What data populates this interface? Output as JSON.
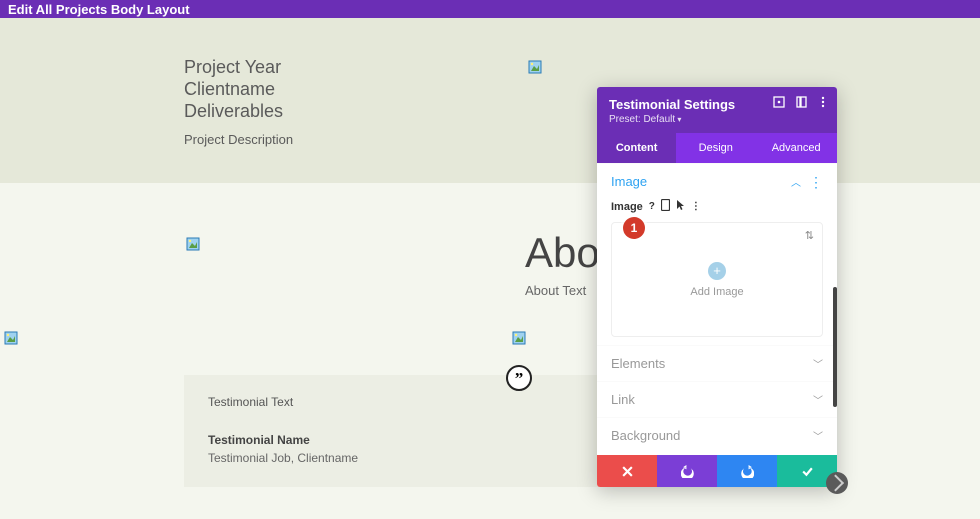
{
  "topbar": {
    "title": "Edit All Projects Body Layout"
  },
  "project": {
    "line1": "Project Year",
    "line2": "Clientname",
    "line3": "Deliverables",
    "desc": "Project Description"
  },
  "about": {
    "heading": "Abo",
    "text": "About Text"
  },
  "testimonial": {
    "text": "Testimonial Text",
    "name": "Testimonial Name",
    "job": "Testimonial Job, Clientname",
    "quote": "”"
  },
  "panel": {
    "title": "Testimonial Settings",
    "preset": "Preset: Default",
    "tabs": {
      "content": "Content",
      "design": "Design",
      "advanced": "Advanced"
    },
    "groups": {
      "image": "Image",
      "elements": "Elements",
      "link": "Link",
      "background": "Background"
    },
    "imageOption": {
      "label": "Image",
      "addImage": "Add Image"
    }
  },
  "callouts": {
    "c1": "1"
  }
}
